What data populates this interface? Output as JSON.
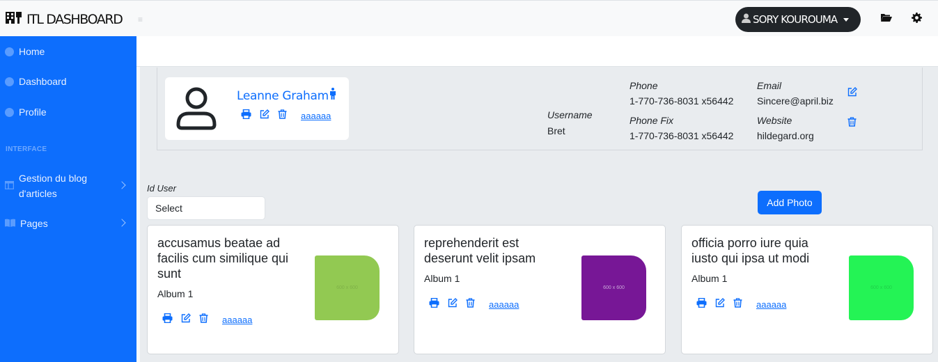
{
  "app": {
    "title": "ITL DASHBOARD"
  },
  "header": {
    "user_name": "SORY KOUROUMA"
  },
  "sidebar": {
    "items": [
      {
        "label": "Home"
      },
      {
        "label": "Dashboard"
      },
      {
        "label": "Profile"
      }
    ],
    "section_heading": "INTERFACE",
    "groups": [
      {
        "label_line1": "Gestion du blog",
        "label_line2": "d'articles"
      },
      {
        "label": "Pages"
      }
    ]
  },
  "profile": {
    "name": "Leanne Graham",
    "link_text": "aaaaaa",
    "username_label": "Username",
    "username": "Bret",
    "phone_label": "Phone",
    "phone": "1-770-736-8031 x56442",
    "phone_fix_label": "Phone Fix",
    "phone_fix": "1-770-736-8031 x56442",
    "email_label": "Email",
    "email": "Sincere@april.biz",
    "website_label": "Website",
    "website": "hildegard.org"
  },
  "filter": {
    "label": "Id User",
    "select_value": "Select"
  },
  "add_photo_label": "Add Photo",
  "cards": [
    {
      "title": "accusamus beatae ad facilis cum similique qui sunt",
      "album": "Album 1",
      "thumb_text": "600 x 600",
      "thumb_color": "#92c952",
      "thumb_text_color": "#7fb148",
      "link_text": "aaaaaa"
    },
    {
      "title": "reprehenderit est deserunt velit ipsam",
      "album": "Album 1",
      "thumb_text": "600 x 600",
      "thumb_color": "#771796",
      "thumb_text_color": "#c9a6d8",
      "link_text": "aaaaaa"
    },
    {
      "title": "officia porro iure quia iusto qui ipsa ut modi",
      "album": "Album 1",
      "thumb_text": "600 x 600",
      "thumb_color": "#24f355",
      "thumb_text_color": "#1fd04a",
      "link_text": "aaaaaa"
    }
  ],
  "colors": {
    "primary": "#0d6efd",
    "dark": "#212529"
  }
}
